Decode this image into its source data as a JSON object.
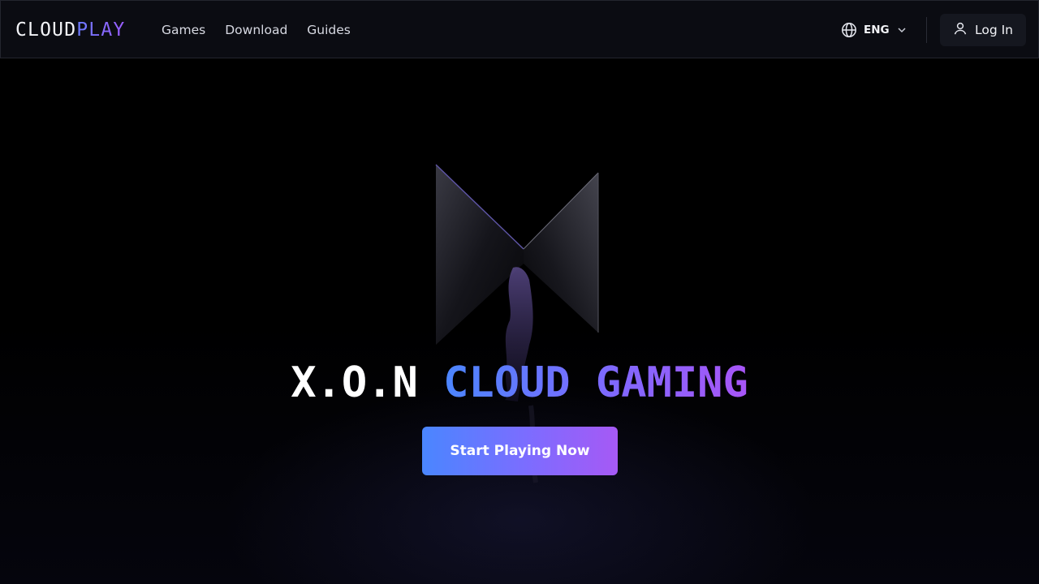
{
  "brand": {
    "part1": "CLOUD",
    "part2": "PLAY"
  },
  "nav": {
    "links": [
      {
        "label": "Games"
      },
      {
        "label": "Download"
      },
      {
        "label": "Guides"
      }
    ],
    "language": {
      "label": "ENG",
      "icon": "globe-icon"
    },
    "login": {
      "label": "Log In",
      "icon": "user-icon"
    }
  },
  "hero": {
    "title_part1": "X.O.N",
    "title_part2": "CLOUD GAMING",
    "cta_label": "Start Playing Now"
  },
  "colors": {
    "accent_start": "#4a86ff",
    "accent_end": "#a659f5",
    "nav_bg": "#0b0c12"
  }
}
